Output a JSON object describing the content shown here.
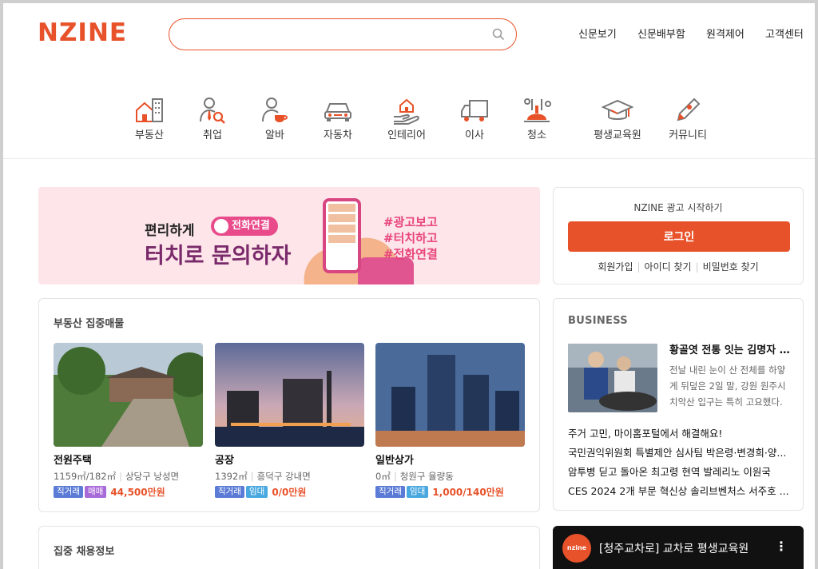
{
  "header": {
    "logo": "NZINE",
    "search_value": "",
    "nav": [
      "신문보기",
      "신문배부함",
      "원격제어",
      "고객센터"
    ]
  },
  "categories": [
    {
      "label": "부동산",
      "icon": "building-icon"
    },
    {
      "label": "취업",
      "icon": "person-search-icon"
    },
    {
      "label": "알바",
      "icon": "person-cup-icon"
    },
    {
      "label": "자동차",
      "icon": "car-icon"
    },
    {
      "label": "인테리어",
      "icon": "house-hand-icon"
    },
    {
      "label": "이사",
      "icon": "truck-icon"
    },
    {
      "label": "청소",
      "icon": "cleaning-icon"
    },
    {
      "label": "평생교육원",
      "icon": "graduation-cap-icon"
    },
    {
      "label": "커뮤니티",
      "icon": "pen-icon"
    }
  ],
  "banner": {
    "line1": "편리하게",
    "pill": "전화연결",
    "line2": "터치로 문의하자",
    "tags": [
      "#광고보고",
      "#터치하고",
      "#전화연결"
    ]
  },
  "login": {
    "title": "NZINE 광고 시작하기",
    "button": "로그인",
    "links": [
      "회원가입",
      "아이디 찾기",
      "비밀번호 찾기"
    ]
  },
  "realestate": {
    "title": "부동산 집중매물",
    "items": [
      {
        "title": "전원주택",
        "area": "1159㎡/182㎡",
        "location": "상당구 낭성면",
        "badges": [
          "직거래",
          "매매"
        ],
        "price": "44,500만원"
      },
      {
        "title": "공장",
        "area": "1392㎡",
        "location": "흥덕구 강내면",
        "badges": [
          "직거래",
          "임대"
        ],
        "price": "0/0만원"
      },
      {
        "title": "일반상가",
        "area": "0㎡",
        "location": "청원구 율량동",
        "badges": [
          "직거래",
          "임대"
        ],
        "price": "1,000/140만원"
      }
    ]
  },
  "business": {
    "title": "BUSINESS",
    "headline": "황골엿 전통 잇는 김명자 명인",
    "desc": "전날 내린 눈이 산 전체를 하얗게 뒤덮은 2일 말, 강원 원주시 치악산 입구는 특히 고요했다.",
    "list": [
      "주거 고민, 마이홈포털에서 해결해요!",
      "국민권익위원회 특별제안 심사팀 박은령·변경희·양...",
      "암투병 딛고 돌아온 최고령 현역 발레리노 이원국",
      "CES 2024 2개 부문 혁신상 솔리브벤처스 서주호 ..."
    ]
  },
  "jobs": {
    "title": "집중 채용정보"
  },
  "video": {
    "channel": "nzine",
    "title": "[청주교차로] 교차로 평생교육원"
  },
  "colors": {
    "accent": "#e8522a",
    "badge_direct": "#5b7bd6",
    "badge_sale": "#a86ad8",
    "badge_lease": "#4aa8e0"
  }
}
